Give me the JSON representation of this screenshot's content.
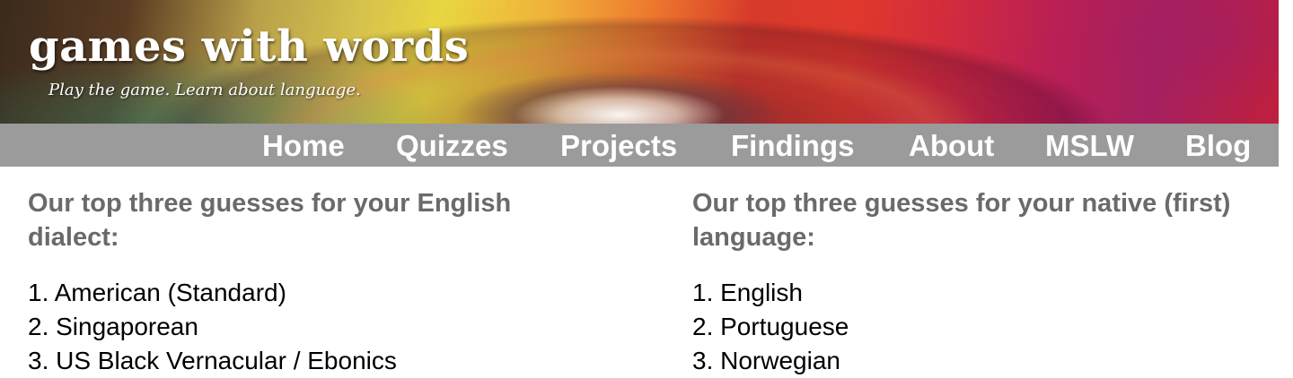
{
  "site": {
    "title": "games with words",
    "tagline": "Play the game. Learn about language."
  },
  "nav": {
    "items": [
      {
        "label": "Home"
      },
      {
        "label": "Quizzes"
      },
      {
        "label": "Projects"
      },
      {
        "label": "Findings"
      },
      {
        "label": "About"
      },
      {
        "label": "MSLW"
      },
      {
        "label": "Blog"
      }
    ]
  },
  "results": {
    "dialect": {
      "heading": "Our top three guesses for your English dialect:",
      "guesses": [
        "1. American (Standard)",
        "2. Singaporean",
        "3. US Black Vernacular / Ebonics"
      ]
    },
    "native": {
      "heading": "Our top three guesses for your native (first) language:",
      "guesses": [
        "1. English",
        "2. Portuguese",
        "3. Norwegian"
      ]
    }
  }
}
